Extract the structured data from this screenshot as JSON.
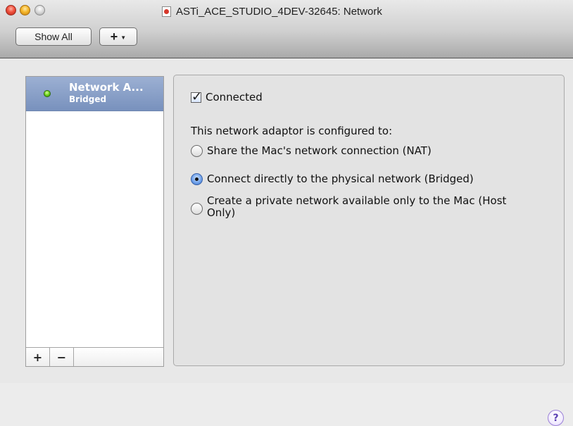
{
  "window": {
    "title": "ASTi_ACE_STUDIO_4DEV-32645: Network",
    "controls": [
      "close-icon",
      "minimize-icon",
      "zoom-icon"
    ]
  },
  "toolbar": {
    "show_all_label": "Show All",
    "add_label": "+",
    "add_menu_icon": "chevron-down-icon"
  },
  "sidebar": {
    "items": [
      {
        "name": "Network A...",
        "sub": "Bridged",
        "status_color": "#54c21a"
      }
    ],
    "add_button": "+",
    "remove_button": "−"
  },
  "panel": {
    "connected_label": "Connected",
    "connected_checked": true,
    "configured_text": "This network adaptor is configured to:",
    "options": [
      {
        "label": "Share the Mac's network connection (NAT)",
        "selected": false
      },
      {
        "label": "Connect directly to the physical network (Bridged)",
        "selected": true
      },
      {
        "label": "Create a private network available only to the Mac (Host Only)",
        "selected": false
      }
    ],
    "help_label": "?"
  },
  "colors": {
    "selection_highlight": "#8fa6d0",
    "help_accent": "#5b3fb3"
  }
}
